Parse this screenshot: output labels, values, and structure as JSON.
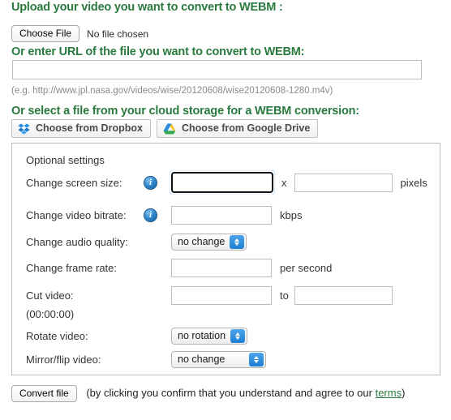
{
  "upload": {
    "heading": "Upload your video you want to convert to WEBM :",
    "choose_file_label": "Choose File",
    "file_status": "No file chosen"
  },
  "url": {
    "heading": "Or enter URL of the file you want to convert to WEBM:",
    "value": "",
    "placeholder": "",
    "hint": "(e.g. http://www.jpl.nasa.gov/videos/wise/20120608/wise20120608-1280.m4v)"
  },
  "cloud": {
    "heading": "Or select a file from your cloud storage for a WEBM conversion:",
    "dropbox_label": "Choose from Dropbox",
    "gdrive_label": "Choose from Google Drive",
    "dropbox_icon": "dropbox-icon",
    "gdrive_icon": "google-drive-icon"
  },
  "settings": {
    "title": "Optional settings",
    "info_icon": "info-icon",
    "rows": [
      {
        "label": "Change screen size:",
        "has_info": true,
        "width_value": "",
        "separator": "x",
        "height_value": "",
        "unit": "pixels",
        "focused": true
      },
      {
        "label": "Change video bitrate:",
        "has_info": true,
        "value": "",
        "unit": "kbps"
      },
      {
        "label": "Change audio quality:",
        "has_info": false,
        "selected": "no change",
        "options": [
          "no change"
        ]
      },
      {
        "label": "Change frame rate:",
        "has_info": false,
        "value": "",
        "unit": "per second"
      },
      {
        "label": "Cut video:",
        "has_info": false,
        "start_value": "",
        "separator": "to",
        "end_value": "",
        "note": "(00:00:00)"
      },
      {
        "label": "Rotate video:",
        "has_info": false,
        "selected": "no rotation",
        "options": [
          "no rotation"
        ]
      },
      {
        "label": "Mirror/flip video:",
        "has_info": false,
        "selected": "no change",
        "options": [
          "no change"
        ]
      }
    ]
  },
  "footer": {
    "convert_label": "Convert file",
    "terms_prefix": "(by clicking you confirm that you understand and agree to our ",
    "terms_link": "terms",
    "terms_suffix": ")"
  },
  "colors": {
    "heading_green": "#2a7a3e",
    "link_green": "#2a7a3e",
    "focus_blue": "#6aaceb",
    "info_blue": "#2f87c9"
  }
}
